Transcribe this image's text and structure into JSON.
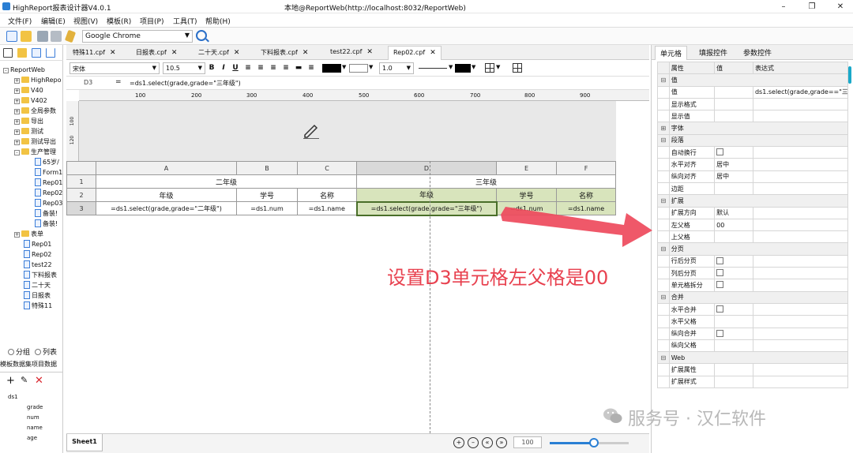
{
  "window": {
    "app_title": "HighReport报表设计器V4.0.1",
    "location": "本地@ReportWeb(http://localhost:8032/ReportWeb)"
  },
  "menu": [
    "文件(F)",
    "编辑(E)",
    "视图(V)",
    "模板(R)",
    "项目(P)",
    "工具(T)",
    "帮助(H)"
  ],
  "toolbar": {
    "browser": "Google Chrome"
  },
  "tree": {
    "root": "ReportWeb",
    "folders": [
      "HighRepo",
      "V40",
      "V402",
      "全局参数",
      "导出",
      "测试",
      "测试导出",
      "生产管理"
    ],
    "prod_items": [
      "65岁/",
      "Form1",
      "Rep01",
      "Rep02",
      "Rep03",
      "备装!",
      "备装!"
    ],
    "folder2": "表单",
    "files": [
      "Rep01",
      "Rep02",
      "test22",
      "下料报表",
      "二十天",
      "日报表",
      "特殊11"
    ]
  },
  "left_bottom": {
    "radio1": "分组",
    "radio2": "列表",
    "tabs": "模板数据集项目数据",
    "ds": "ds1",
    "fields": [
      "grade",
      "num",
      "name",
      "age"
    ]
  },
  "tabs": [
    "特殊11.cpf",
    "日报表.cpf",
    "二十天.cpf",
    "下料报表.cpf",
    "test22.cpf",
    "Rep02.cpf"
  ],
  "format": {
    "font": "宋体",
    "size": "10.5",
    "line_width": "1.0"
  },
  "formula": {
    "cell_ref": "D3",
    "eq": "=",
    "expr": "=ds1.select(grade,grade=\"三年级\")"
  },
  "ruler_marks": [
    "100",
    "200",
    "300",
    "400",
    "500",
    "600",
    "700",
    "800",
    "900"
  ],
  "vruler_marks": [
    "100",
    "120"
  ],
  "sheet": {
    "cols": [
      "A",
      "B",
      "C",
      "D",
      "E",
      "F"
    ],
    "rows": [
      "1",
      "2",
      "3"
    ],
    "r1_left": "二年级",
    "r1_right": "三年级",
    "r2": [
      "年级",
      "学号",
      "名称",
      "年级",
      "学号",
      "名称"
    ],
    "r3": [
      "=ds1.select(grade,grade=\"二年级\")",
      "=ds1.num",
      "=ds1.name",
      "=ds1.select(grade,grade=\"三年级\")",
      "=ds1.num",
      "=ds1.name"
    ]
  },
  "sheet_tab": "Sheet1",
  "zoom": "100",
  "annotation": "设置D3单元格左父格是00",
  "watermark": "服务号 · 汉仁软件",
  "right": {
    "tabs": [
      "单元格",
      "填报控件",
      "参数控件"
    ],
    "headers": [
      "属性",
      "值",
      "表达式"
    ],
    "rows": [
      {
        "g": true,
        "name": "值"
      },
      {
        "name": "值",
        "expr": "ds1.select(grade,grade==\"三..."
      },
      {
        "name": "显示格式"
      },
      {
        "name": "显示值"
      },
      {
        "g": true,
        "name": "字体",
        "collapsed": true
      },
      {
        "g": true,
        "name": "段落"
      },
      {
        "name": "自动换行",
        "cb": true
      },
      {
        "name": "水平对齐",
        "val": "居中"
      },
      {
        "name": "纵向对齐",
        "val": "居中"
      },
      {
        "name": "边距"
      },
      {
        "g": true,
        "name": "扩展"
      },
      {
        "name": "扩展方向",
        "val": "默认"
      },
      {
        "name": "左父格",
        "val": "00"
      },
      {
        "name": "上父格"
      },
      {
        "g": true,
        "name": "分页"
      },
      {
        "name": "行后分页",
        "cb": true
      },
      {
        "name": "列后分页",
        "cb": true
      },
      {
        "name": "单元格拆分",
        "cb": true
      },
      {
        "g": true,
        "name": "合并"
      },
      {
        "name": "水平合并",
        "cb": true
      },
      {
        "name": "水平父格"
      },
      {
        "name": "纵向合并",
        "cb": true
      },
      {
        "name": "纵向父格"
      },
      {
        "g": true,
        "name": "Web"
      },
      {
        "name": "扩展属性"
      },
      {
        "name": "扩展样式"
      }
    ]
  },
  "colors": {
    "accent": "#2a7fd4",
    "green_cell": "#d8e4bc",
    "annotation": "#e8414f"
  }
}
